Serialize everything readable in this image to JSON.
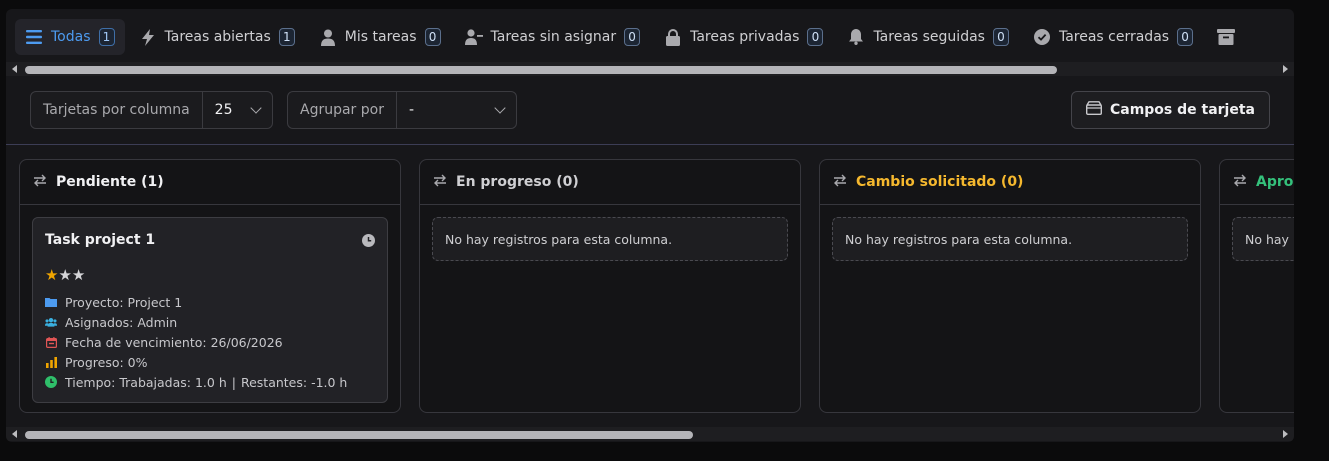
{
  "tabs": [
    {
      "label": "Todas",
      "count": "1",
      "icon": "list-icon"
    },
    {
      "label": "Tareas abiertas",
      "count": "1",
      "icon": "bolt-icon"
    },
    {
      "label": "Mis tareas",
      "count": "0",
      "icon": "user-icon"
    },
    {
      "label": "Tareas sin asignar",
      "count": "0",
      "icon": "user-minus-icon"
    },
    {
      "label": "Tareas privadas",
      "count": "0",
      "icon": "lock-icon"
    },
    {
      "label": "Tareas seguidas",
      "count": "0",
      "icon": "bell-icon"
    },
    {
      "label": "Tareas cerradas",
      "count": "0",
      "icon": "check-circle-icon"
    }
  ],
  "toolbar": {
    "cards_per_column_label": "Tarjetas por columna",
    "cards_per_column_value": "25",
    "group_by_label": "Agrupar por",
    "group_by_value": "-",
    "card_fields_button": "Campos de tarjeta"
  },
  "columns": [
    {
      "title": "Pendiente (1)",
      "color": "#f1f1f3"
    },
    {
      "title": "En progreso (0)",
      "color": "#cfcfd2",
      "empty": "No hay registros para esta columna."
    },
    {
      "title": "Cambio solicitado (0)",
      "color": "#f5b82e",
      "empty": "No hay registros para esta columna."
    },
    {
      "title": "Aprob",
      "color": "#34c17b",
      "empty": "No hay re"
    }
  ],
  "card": {
    "title": "Task project 1",
    "rating": 1,
    "rating_max": 3,
    "project": "Proyecto: Project 1",
    "assignees": "Asignados: Admin",
    "due": "Fecha de vencimiento: 26/06/2026",
    "progress": "Progreso: 0%",
    "time_worked": "Tiempo: Trabajadas: 1.0 h",
    "time_sep": "|",
    "time_left": "Restantes: -1.0 h"
  },
  "colors": {
    "accent": "#4d9bf0",
    "star": "#f0a500",
    "folder": "#4d9bf0",
    "users": "#3ab0e0",
    "calendar": "#e05555",
    "bars": "#f0a500",
    "clock": "#2fbf6a"
  }
}
